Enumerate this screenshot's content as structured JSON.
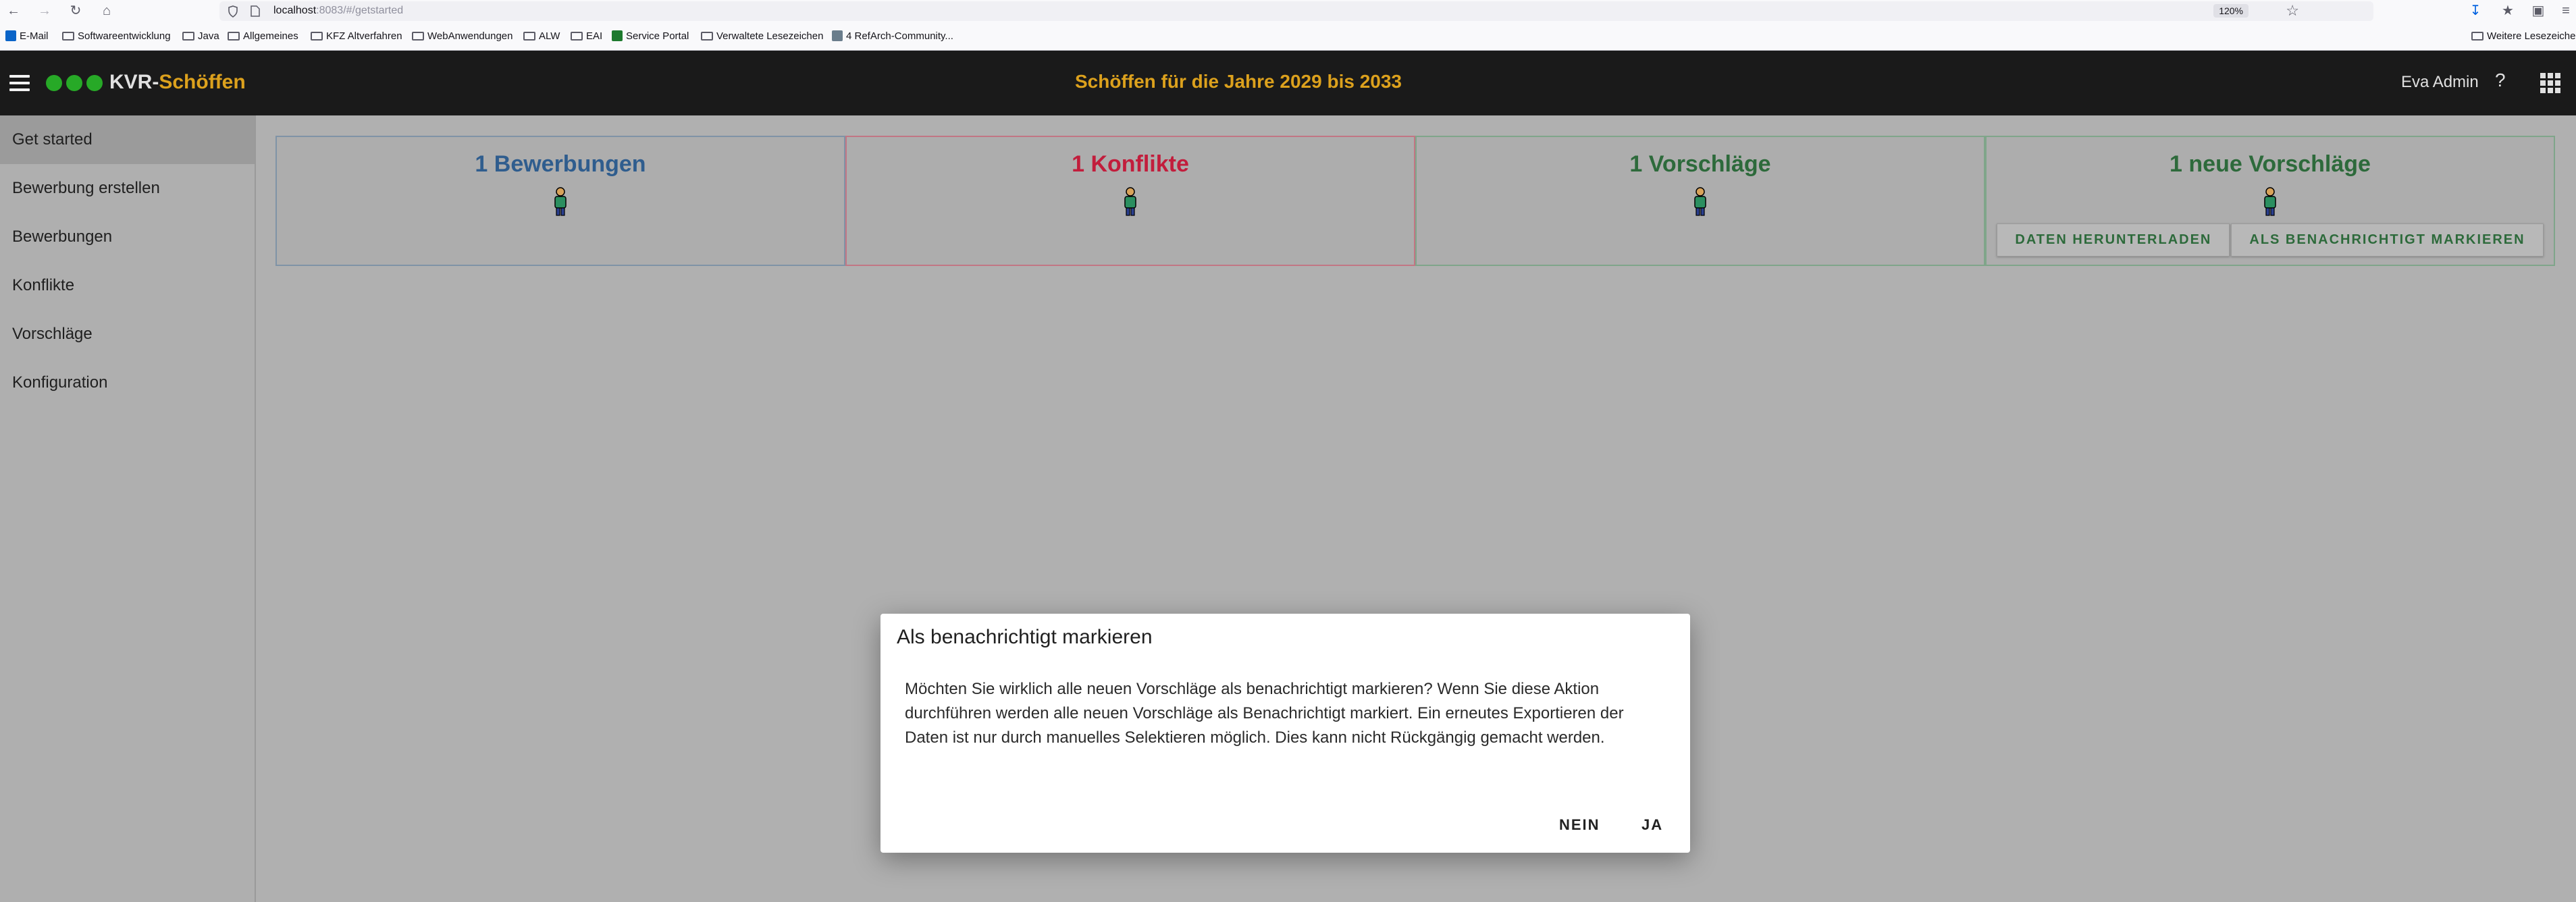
{
  "browser": {
    "url_host": "localhost",
    "url_rest": ":8083/#/getstarted",
    "zoom": "120%",
    "bookmarks": [
      {
        "label": "E-Mail",
        "icon": "outlook-icon"
      },
      {
        "label": "Softwareentwicklung",
        "icon": "folder-icon"
      },
      {
        "label": "Java",
        "icon": "folder-icon"
      },
      {
        "label": "Allgemeines",
        "icon": "folder-icon"
      },
      {
        "label": "KFZ Altverfahren",
        "icon": "folder-icon"
      },
      {
        "label": "WebAnwendungen",
        "icon": "folder-icon"
      },
      {
        "label": "ALW",
        "icon": "folder-icon"
      },
      {
        "label": "EAI",
        "icon": "folder-icon"
      },
      {
        "label": "Service Portal",
        "icon": "site-icon"
      },
      {
        "label": "Verwaltete Lesezeichen",
        "icon": "folder-icon"
      },
      {
        "label": "4 RefArch-Community...",
        "icon": "site-icon"
      }
    ],
    "other_bookmarks": "Weitere Lesezeichen"
  },
  "app": {
    "title_part1": "KVR-",
    "title_part2": "Schöffen",
    "period_title": "Schöffen für die Jahre 2029 bis 2033",
    "user": "Eva Admin",
    "help": "?"
  },
  "sidebar": {
    "items": [
      {
        "label": "Get started"
      },
      {
        "label": "Bewerbung erstellen"
      },
      {
        "label": "Bewerbungen"
      },
      {
        "label": "Konflikte"
      },
      {
        "label": "Vorschläge"
      },
      {
        "label": "Konfiguration"
      }
    ]
  },
  "cards": [
    {
      "title": "1 Bewerbungen",
      "color": "#2f5d8e"
    },
    {
      "title": "1 Konflikte",
      "color": "#c21d3c"
    },
    {
      "title": "1 Vorschläge",
      "color": "#2d6a3b"
    },
    {
      "title": "1 neue Vorschläge",
      "color": "#2d6a3b",
      "download_label": "DATEN HERUNTERLADEN",
      "mark_label": "ALS BENACHRICHTIGT MARKIEREN"
    }
  ],
  "dialog": {
    "title": "Als benachrichtigt markieren",
    "text": "Möchten Sie wirklich alle neuen Vorschläge als benachrichtigt markieren? Wenn Sie diese Aktion durchführen werden alle neuen Vorschläge als Benachrichtigt markiert. Ein erneutes Exportieren der Daten ist nur durch manuelles Selektieren möglich. Dies kann nicht Rückgängig gemacht werden.",
    "no_label": "NEIN",
    "yes_label": "JA"
  }
}
